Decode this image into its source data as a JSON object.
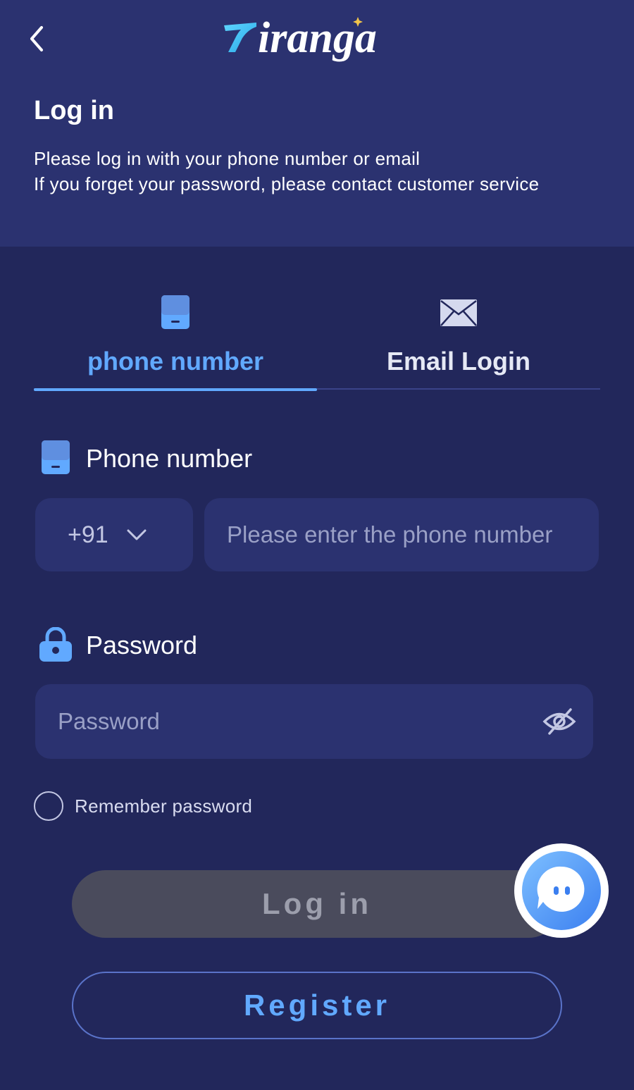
{
  "header": {
    "logo_text": "Tiranga",
    "title": "Log in",
    "subtitle_line1": "Please log in with your phone number or email",
    "subtitle_line2": "If you forget your password, please contact customer service"
  },
  "tabs": [
    {
      "label": "phone number",
      "icon": "phone-icon",
      "active": true
    },
    {
      "label": "Email Login",
      "icon": "envelope-icon",
      "active": false
    }
  ],
  "phone_section": {
    "label": "Phone number",
    "country_code": "+91",
    "placeholder": "Please enter the phone number",
    "value": ""
  },
  "password_section": {
    "label": "Password",
    "placeholder": "Password",
    "value": ""
  },
  "remember": {
    "label": "Remember password",
    "checked": false
  },
  "buttons": {
    "login": "Log in",
    "register": "Register"
  },
  "icons": {
    "back": "chevron-left-icon",
    "visibility": "eye-off-icon",
    "lock": "lock-icon",
    "support": "customer-service-icon"
  },
  "colors": {
    "accent": "#61a9ff",
    "background": "#22275b",
    "header_bg": "#2b3270",
    "input_bg": "#2b3270",
    "login_button": "#4a4b5c"
  }
}
